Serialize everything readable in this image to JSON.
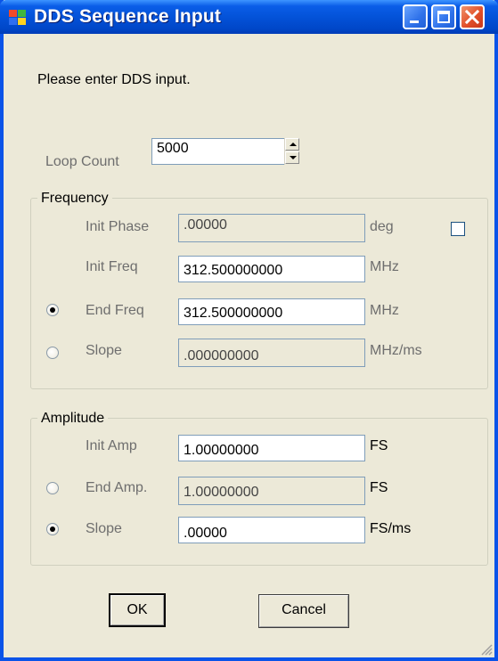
{
  "window": {
    "title": "DDS Sequence Input"
  },
  "prompt": "Please enter DDS input.",
  "loop": {
    "label": "Loop Count",
    "value": "5000"
  },
  "frequency": {
    "group_label": "Frequency",
    "init_phase": {
      "label": "Init Phase",
      "value": ".00000",
      "unit": "deg",
      "checked": false
    },
    "init_freq": {
      "label": "Init Freq",
      "value": "312.500000000",
      "unit": "MHz"
    },
    "end_freq": {
      "label": "End Freq",
      "value": "312.500000000",
      "unit": "MHz",
      "selected": true
    },
    "slope": {
      "label": "Slope",
      "value": ".000000000",
      "unit": "MHz/ms",
      "selected": false
    }
  },
  "amplitude": {
    "group_label": "Amplitude",
    "init_amp": {
      "label": "Init Amp",
      "value": "1.00000000",
      "unit": "FS"
    },
    "end_amp": {
      "label": "End Amp.",
      "value": "1.00000000",
      "unit": "FS",
      "selected": false
    },
    "slope": {
      "label": "Slope",
      "value": ".00000",
      "unit": "FS/ms",
      "selected": true
    }
  },
  "buttons": {
    "ok": "OK",
    "cancel": "Cancel"
  },
  "colors": {
    "titlebar": "#0a5de8",
    "frame": "#0a53e8",
    "dialog_bg": "#ece9d8",
    "close_button": "#e2502a"
  }
}
